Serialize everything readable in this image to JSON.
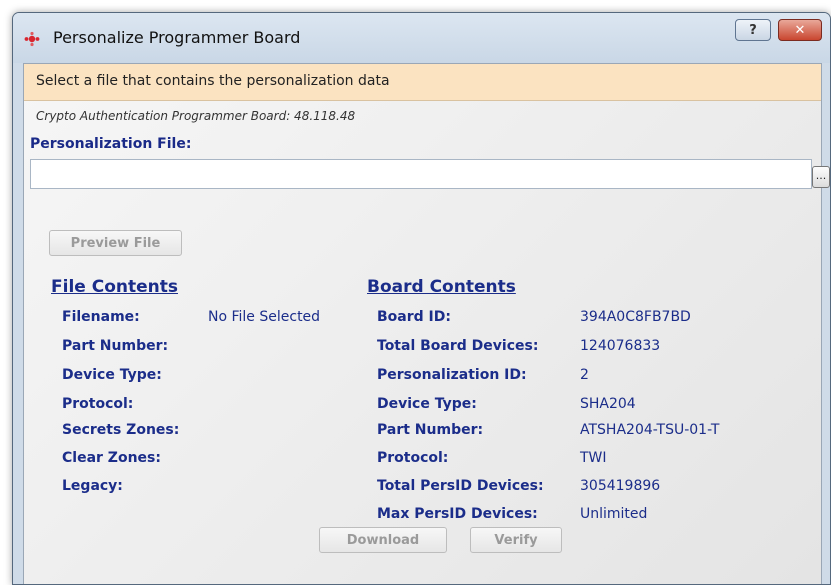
{
  "window": {
    "title": "Personalize Programmer Board",
    "help_label": "?",
    "close_label": "✕"
  },
  "instruction": "Select a file that contains the personalization data",
  "board_info": "Crypto Authentication Programmer Board: 48.118.48",
  "personalization": {
    "label": "Personalization File:",
    "value": "",
    "placeholder": "",
    "browse_label": "..."
  },
  "buttons": {
    "preview": "Preview File",
    "download": "Download",
    "verify": "Verify"
  },
  "file_contents": {
    "title": "File Contents",
    "rows": [
      {
        "label": "Filename:",
        "value": "No File Selected"
      },
      {
        "label": "Part Number:",
        "value": ""
      },
      {
        "label": "Device Type:",
        "value": ""
      },
      {
        "label": "Protocol:",
        "value": ""
      },
      {
        "label": "Secrets Zones:",
        "value": ""
      },
      {
        "label": "Clear Zones:",
        "value": ""
      },
      {
        "label": "Legacy:",
        "value": ""
      }
    ]
  },
  "board_contents": {
    "title": "Board Contents",
    "rows": [
      {
        "label": "Board ID:",
        "value": "394A0C8FB7BD"
      },
      {
        "label": "Total Board Devices:",
        "value": "124076833"
      },
      {
        "label": "Personalization ID:",
        "value": "2"
      },
      {
        "label": "Device Type:",
        "value": "SHA204"
      },
      {
        "label": "Part Number:",
        "value": "ATSHA204-TSU-01-T"
      },
      {
        "label": "Protocol:",
        "value": "TWI"
      },
      {
        "label": "Total PersID Devices:",
        "value": "305419896"
      },
      {
        "label": "Max PersID Devices:",
        "value": "Unlimited"
      }
    ]
  },
  "colors": {
    "accent": "#1b2d8a",
    "instruction_bg": "#fbe3c1",
    "close_button": "#c9462f"
  },
  "icons": {
    "app": "app-dots-icon"
  }
}
